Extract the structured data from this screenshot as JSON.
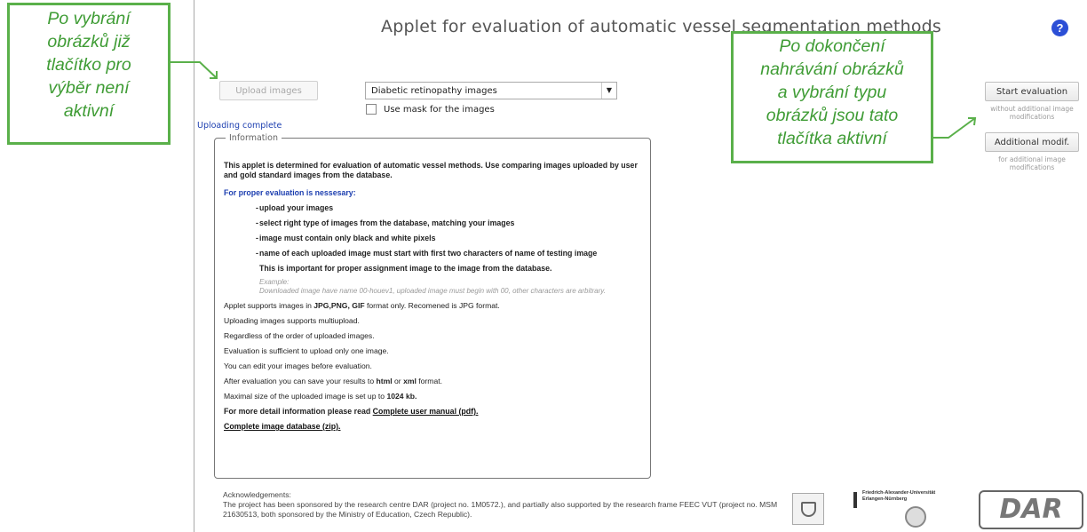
{
  "applet": {
    "title": "Applet for evaluation of automatic vessel segmentation methods",
    "help_glyph": "?",
    "upload_button": "Upload images",
    "image_type_select": "Diabetic retinopathy images",
    "mask_label": "Use mask for the images",
    "status": "Uploading complete",
    "start_button": "Start evaluation",
    "start_note": "without additional image modifications",
    "modif_button": "Additional modif.",
    "modif_note": "for additional image modifications"
  },
  "information": {
    "legend": "Information",
    "intro": "This applet is determined for evaluation of automatic vessel methods. Use comparing images uploaded by user and gold standard images from the database.",
    "subhead": "For proper evaluation is nessesary:",
    "requirements": [
      "upload your images",
      "select right type of images from the database, matching your images",
      "image must contain only black and white pixels",
      "name of each uploaded image must start with first two characters of name of testing image"
    ],
    "requirement_note": "This is important for proper assignment image to the image from the database.",
    "example_label": "Example:",
    "example_text": "Downloaded image have name 00-houev1, uploaded image must begin with 00, other characters are arbitrary.",
    "formats_prefix": "Applet supports images in ",
    "formats_bold": "JPG,PNG, GIF",
    "formats_suffix": " format only. Recomened is JPG format.",
    "lines": [
      "Uploading images supports multiupload.",
      "Regardless of the order of uploaded images.",
      "Evaluation is sufficient to upload only one image.",
      "You can edit your images before evaluation."
    ],
    "save_prefix": "After evaluation you can save your results to ",
    "save_html": "html",
    "save_or": " or ",
    "save_xml": "xml",
    "save_suffix": " format.",
    "size_prefix": "Maximal size of the uploaded image is set up to ",
    "size_value": "1024 kb.",
    "more_prefix": "For more detail information please read ",
    "manual_link": "Complete user manual (pdf).",
    "database_link": "Complete image database (zip)."
  },
  "acknowledgements": {
    "heading": "Acknowledgements:",
    "text": "The project has been sponsored by the research centre DAR (project no. 1M0572.), and partially also supported by the research frame FEEC VUT (project no. MSM 21630513, both sponsored by the Ministry of Education, Czech Republic)."
  },
  "logos": {
    "university": "Friedrich-Alexander-Universität Erlangen-Nürnberg",
    "dar": "DAR"
  },
  "callouts": {
    "left_lines": [
      "Po vybrání",
      "obrázků již",
      "tlačítko pro",
      "výběr není",
      "aktivní"
    ],
    "right_lines": [
      "Po dokončení",
      "nahrávání obrázků",
      "a vybrání typu",
      "obrázků jsou tato",
      "tlačítka aktivní"
    ]
  },
  "colors": {
    "callout_green": "#3f9c35",
    "link_blue": "#1d3fb0",
    "help_blue": "#2c4fd6"
  }
}
